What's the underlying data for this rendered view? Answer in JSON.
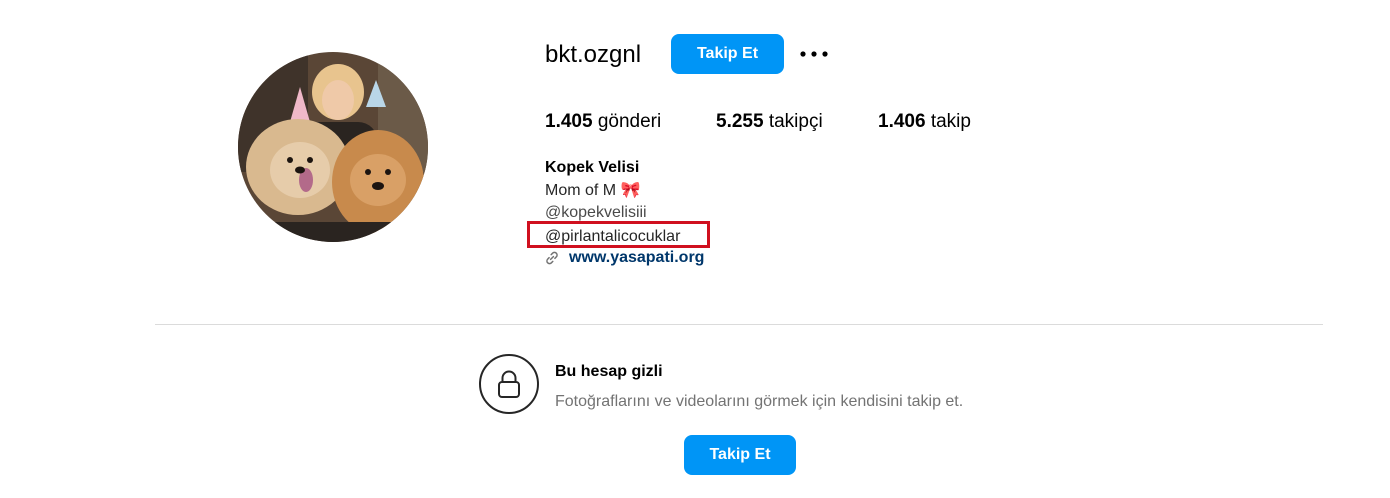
{
  "profile": {
    "username": "bkt.ozgnl",
    "follow_label": "Takip Et",
    "more_icon": "more-options-icon",
    "avatar_icon": "profile-photo"
  },
  "stats": {
    "posts_count": "1.405",
    "posts_label": "gönderi",
    "followers_count": "5.255",
    "followers_label": "takipçi",
    "following_count": "1.406",
    "following_label": "takip"
  },
  "bio": {
    "name": "Kopek Velisi",
    "description": "Mom of M 🎀",
    "mention_1": "@kopekvelisiii",
    "mention_2": "@pirlantalicocuklar",
    "link_icon": "link-icon",
    "link_text": "www.yasapati.org",
    "highlight_color": "#d0101f"
  },
  "private_notice": {
    "lock_icon": "lock-icon",
    "title": "Bu hesap gizli",
    "subtitle": "Fotoğraflarını ve videolarını görmek için kendisini takip et.",
    "follow_label": "Takip Et"
  },
  "colors": {
    "primary_button": "#0095f6",
    "link": "#00376b",
    "secondary_text": "#737373",
    "divider": "#dbdbdb"
  }
}
